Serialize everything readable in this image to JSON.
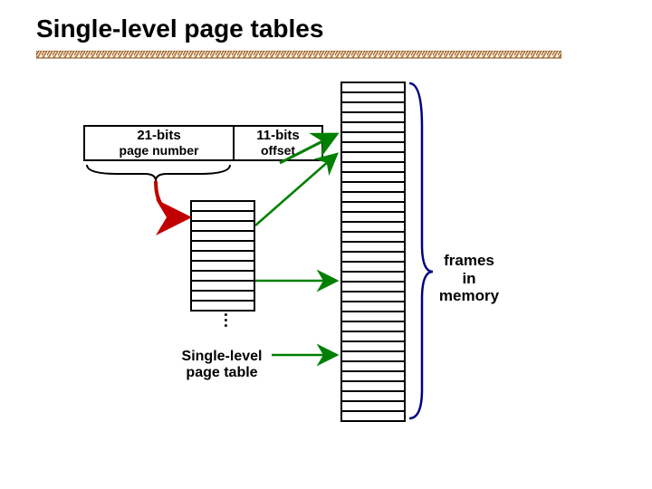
{
  "title": "Single-level page tables",
  "address": {
    "page_bits": "21-bits",
    "page_label": "page number",
    "offset_bits": "11-bits",
    "offset_label": "offset"
  },
  "page_table": {
    "label_line1": "Single-level",
    "label_line2": "page table",
    "ellipsis": "···"
  },
  "memory": {
    "label_line1": "frames",
    "label_line2": "in",
    "label_line3": "memory"
  },
  "colors": {
    "divider1": "#c08040",
    "divider2": "#804000",
    "arrow_red": "#c00000",
    "arrow_green": "#008000",
    "brace_blue": "#000080"
  }
}
